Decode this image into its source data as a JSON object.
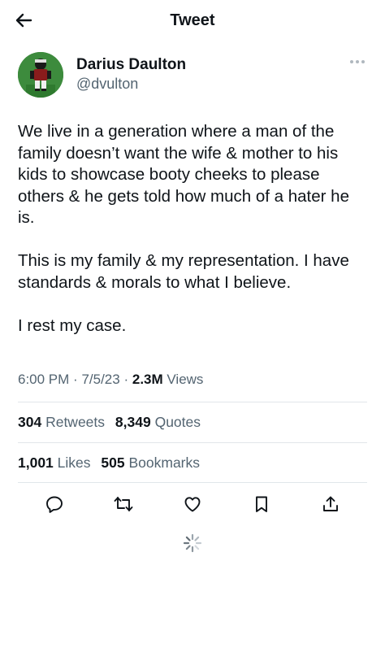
{
  "header": {
    "title": "Tweet",
    "back_icon": "arrow-left-icon"
  },
  "author": {
    "name": "Darius Daulton",
    "handle": "@dvulton",
    "avatar_icon": "avatar-image",
    "more_icon": "more-horizontal-icon"
  },
  "tweet": {
    "paragraphs": [
      "We live in a generation where a man of the family doesn’t want the wife & mother to his kids to showcase booty cheeks to please others & he gets told how much of a hater he is.",
      "This is my family & my representation. I have standards & morals to what I believe.",
      "I rest my case."
    ]
  },
  "meta": {
    "time": "6:00 PM",
    "date": "7/5/23",
    "separator": "·",
    "views": "2.3M",
    "views_label": "Views"
  },
  "stats": {
    "retweets": "304",
    "retweets_label": "Retweets",
    "quotes": "8,349",
    "quotes_label": "Quotes",
    "likes": "1,001",
    "likes_label": "Likes",
    "bookmarks": "505",
    "bookmarks_label": "Bookmarks"
  },
  "actions": [
    "reply-icon",
    "retweet-icon",
    "like-icon",
    "bookmark-icon",
    "share-icon"
  ],
  "colors": {
    "text": "#0f1419",
    "secondary": "#536471",
    "divider": "#e1e6ea",
    "avatar_bg": "#3d8b3d"
  },
  "loading_icon": "spinner-icon"
}
